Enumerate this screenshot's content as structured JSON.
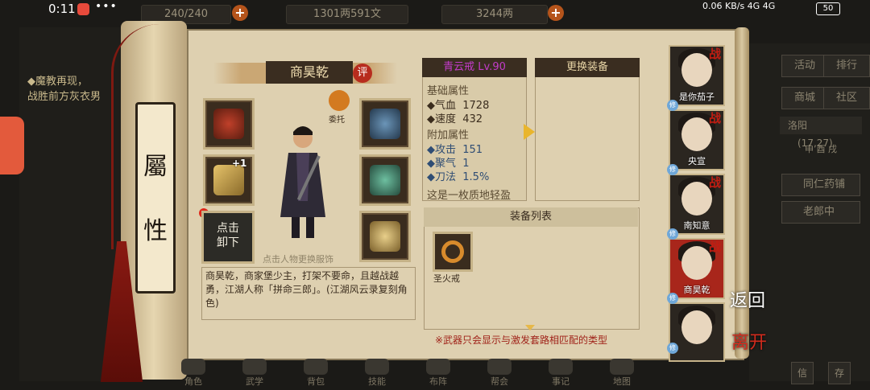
{
  "status_bar": {
    "time": "0:11",
    "more": "•••",
    "network": "0.06 KB/s  4G  4G",
    "battery": "50"
  },
  "resources": {
    "stamina": "240/240",
    "copper": "1301两591文",
    "silver": "3244两"
  },
  "quest": {
    "line1": "◆魔教再现，",
    "line2": "战胜前方灰衣男"
  },
  "scroll": {
    "tab_char1": "屬",
    "tab_char2": "性"
  },
  "character": {
    "name": "商昊乾",
    "review_label": "评",
    "entrust_label": "委托",
    "hint": "点击人物更换服饰",
    "plus_level": "+1",
    "unequip_label1": "点击",
    "unequip_label2": "卸下"
  },
  "description": {
    "text": "商昊乾，商家堡少主，打架不要命，且越战越勇，江湖人称「拼命三郎」。(江湖风云录复刻角色)"
  },
  "equipment": {
    "title": "青云戒 Lv.90",
    "base_label": "基础属性",
    "base_stats": [
      {
        "label": "◆气血",
        "value": "1728"
      },
      {
        "label": "◆速度",
        "value": "432"
      }
    ],
    "extra_label": "附加属性",
    "extra_stats": [
      {
        "label": "◆攻击",
        "value": "151"
      },
      {
        "label": "◆聚气",
        "value": "1"
      },
      {
        "label": "◆刀法",
        "value": "1.5%"
      }
    ],
    "flavor": "这是一枚质地轻盈"
  },
  "swap": {
    "title": "更换装备"
  },
  "equip_list": {
    "title": "装备列表",
    "items": [
      {
        "name": "圣火戒"
      }
    ],
    "footnote": "※武器只会显示与激发套路相匹配的类型"
  },
  "team": [
    {
      "name": "是你茄子",
      "battle": "战",
      "xiu": "修"
    },
    {
      "name": "央宣",
      "battle": "战",
      "xiu": "修"
    },
    {
      "name": "南知意",
      "battle": "战",
      "xiu": "修"
    },
    {
      "name": "商昊乾",
      "battle": "战",
      "xiu": "修"
    },
    {
      "name": "",
      "battle": "",
      "xiu": "修"
    }
  ],
  "right_menu": {
    "activity": "活动",
    "ranking": "排行",
    "shop": "商城",
    "community": "社区",
    "location": "洛阳",
    "coords": "(17,27)",
    "time_slot": "申 酉 戌",
    "shop1": "同仁药铺",
    "shop2": "老郎中"
  },
  "actions": {
    "back": "返回",
    "leave": "离开"
  },
  "bottom_nav": [
    {
      "label": "角色"
    },
    {
      "label": "武学"
    },
    {
      "label": "背包"
    },
    {
      "label": "技能"
    },
    {
      "label": "布阵"
    },
    {
      "label": "帮会"
    },
    {
      "label": "事记"
    },
    {
      "label": "地图"
    }
  ],
  "footer_buttons": {
    "message": "信",
    "other": "存"
  },
  "colors": {
    "accent_gold": "#e6b84a",
    "title_purple": "#c23cc9",
    "stat_blue": "#2f4d74",
    "warn_red": "#a0231a"
  }
}
